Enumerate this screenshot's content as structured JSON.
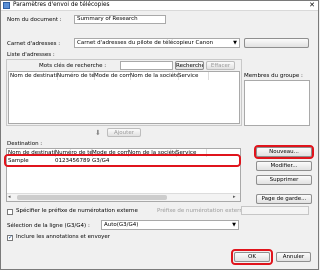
{
  "window": {
    "title": "Paramètres d'envoi de télécopies",
    "close_glyph": "✕"
  },
  "doc_name": {
    "label": "Nom du document :",
    "value": "Summary of Research"
  },
  "address_book": {
    "label": "Carnet d'adresses :",
    "value": "Carnet d'adresses du pilote de télécopieur Canon"
  },
  "address_list": {
    "label": "Liste d'adresses :",
    "search_label": "Mots clés de recherche :",
    "search_button": "Rechercher",
    "clear_button": "Effacer",
    "columns": [
      "Nom de destination",
      "Numéro de téléco...",
      "Mode de commu...",
      "Nom de la société",
      "Service"
    ]
  },
  "group_members_label": "Membres du groupe :",
  "add_button": "Ajouter",
  "destination": {
    "label": "Destination :",
    "columns": [
      "Nom de destination",
      "Numéro de téléco...",
      "Mode de commu...",
      "Nom de la société",
      "Service"
    ],
    "rows": [
      {
        "name": "Sample",
        "number": "0123456789",
        "mode": "G3/G4",
        "company": "",
        "service": ""
      }
    ]
  },
  "buttons": {
    "new": "Nouveau...",
    "modify": "Modifier...",
    "delete": "Supprimer",
    "cover_page": "Page de garde...",
    "ok": "OK",
    "cancel": "Annuler"
  },
  "prefix": {
    "checkbox_label": "Spécifier le préfixe de numérotation externe",
    "checked": false,
    "field_label": "Préfixe de numérotation externe :",
    "value": ""
  },
  "line_selection": {
    "label": "Sélection de la ligne (G3/G4) :",
    "value": "Auto(G3/G4)"
  },
  "include_annotations": {
    "label": "Inclure les annotations et envoyer",
    "checked": true
  },
  "icons": {
    "title": "fax-window-icon",
    "add": "down-arrow-icon",
    "select": "chevron-down-icon"
  },
  "colors": {
    "highlight": "#e0141c"
  }
}
